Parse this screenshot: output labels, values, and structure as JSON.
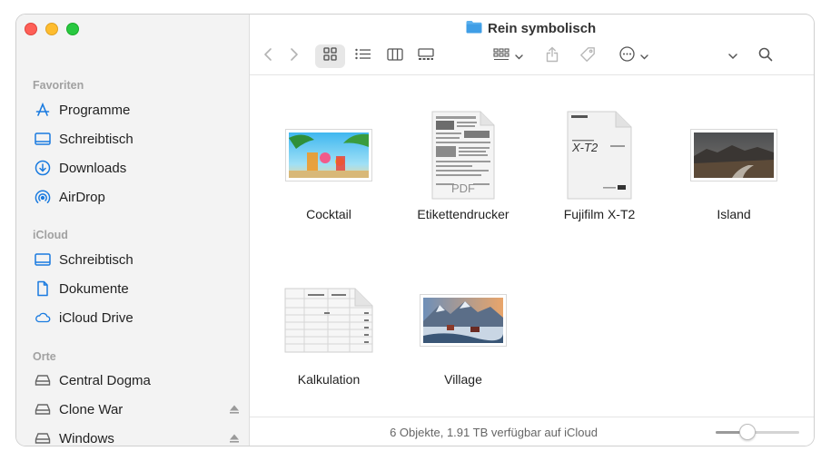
{
  "window": {
    "title": "Rein symbolisch",
    "folder_icon": "folder-icon",
    "accent": "#1a7be0",
    "traffic_lights": {
      "close": "#fe5f57",
      "minimize": "#febc2e",
      "zoom": "#28c840"
    }
  },
  "toolbar": {
    "back": "chevron-left-icon",
    "forward": "chevron-right-icon",
    "views": [
      "icon-view",
      "list-view",
      "column-view",
      "gallery-view"
    ],
    "active_view": "icon-view",
    "group": "group-icon",
    "share": "share-icon",
    "tag": "tag-icon",
    "action": "more-icon",
    "search": "search-icon"
  },
  "sidebar": {
    "sections": [
      {
        "title": "Favoriten",
        "items": [
          {
            "label": "Programme",
            "icon": "apps-icon"
          },
          {
            "label": "Schreibtisch",
            "icon": "desktop-icon"
          },
          {
            "label": "Downloads",
            "icon": "download-icon"
          },
          {
            "label": "AirDrop",
            "icon": "airdrop-icon"
          }
        ]
      },
      {
        "title": "iCloud",
        "items": [
          {
            "label": "Schreibtisch",
            "icon": "desktop-icon"
          },
          {
            "label": "Dokumente",
            "icon": "document-icon"
          },
          {
            "label": "iCloud Drive",
            "icon": "cloud-icon"
          }
        ]
      },
      {
        "title": "Orte",
        "items": [
          {
            "label": "Central Dogma",
            "icon": "drive-icon"
          },
          {
            "label": "Clone War",
            "icon": "drive-icon",
            "ejectable": true
          },
          {
            "label": "Windows",
            "icon": "drive-icon",
            "ejectable": true
          }
        ]
      }
    ]
  },
  "files": [
    {
      "name": "Cocktail",
      "kind": "image"
    },
    {
      "name": "Etikettendrucker",
      "kind": "pdf",
      "badge": "PDF"
    },
    {
      "name": "Fujifilm X-T2",
      "kind": "pdf",
      "cover_text": "X-T2"
    },
    {
      "name": "Island",
      "kind": "image"
    },
    {
      "name": "Kalkulation",
      "kind": "spreadsheet"
    },
    {
      "name": "Village",
      "kind": "image"
    }
  ],
  "status": {
    "text": "6 Objekte, 1.91 TB verfügbar auf iCloud",
    "icon_size_fraction": 0.35
  }
}
